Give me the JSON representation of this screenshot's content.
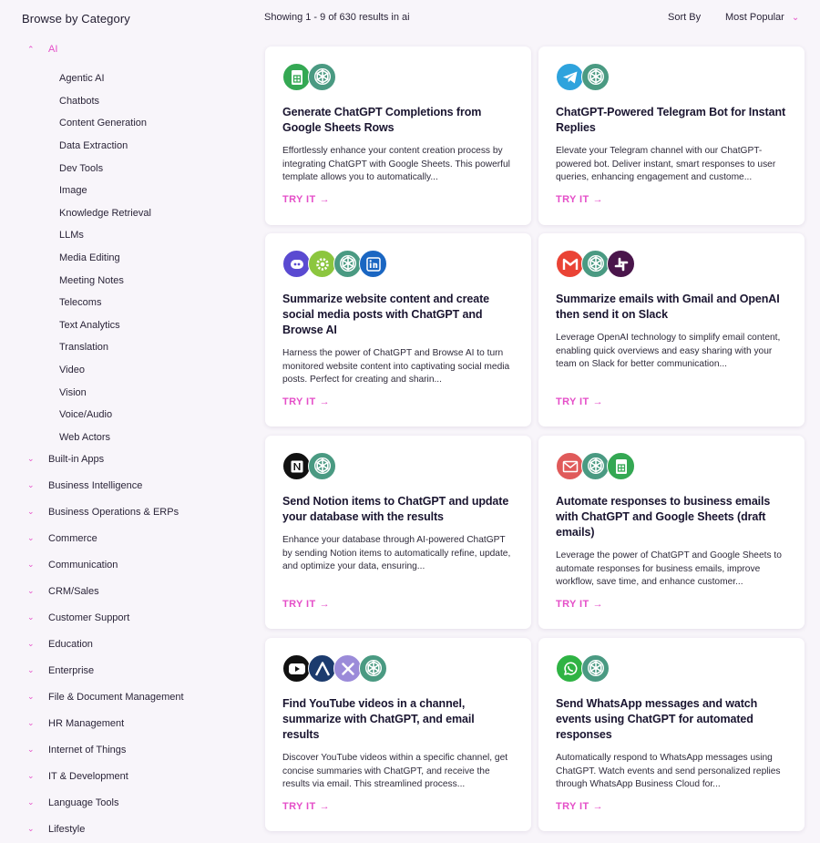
{
  "sidebar": {
    "title": "Browse by Category",
    "active_category": "AI",
    "subcategories": [
      "Agentic AI",
      "Chatbots",
      "Content Generation",
      "Data Extraction",
      "Dev Tools",
      "Image",
      "Knowledge Retrieval",
      "LLMs",
      "Media Editing",
      "Meeting Notes",
      "Telecoms",
      "Text Analytics",
      "Translation",
      "Video",
      "Vision",
      "Voice/Audio",
      "Web Actors"
    ],
    "categories": [
      "Built-in Apps",
      "Business Intelligence",
      "Business Operations & ERPs",
      "Commerce",
      "Communication",
      "CRM/Sales",
      "Customer Support",
      "Education",
      "Enterprise",
      "File & Document Management",
      "HR Management",
      "Internet of Things",
      "IT & Development",
      "Language Tools",
      "Lifestyle"
    ]
  },
  "topbar": {
    "results_text": "Showing 1 - 9 of 630 results in ai",
    "sort_label": "Sort By",
    "sort_value": "Most Popular"
  },
  "cards": [
    {
      "title": "Generate ChatGPT Completions from Google Sheets Rows",
      "desc": "Effortlessly enhance your content creation process by integrating ChatGPT with Google Sheets. This powerful template allows you to automatically...",
      "cta": "TRY IT",
      "icons": [
        "google-sheets-icon",
        "chatgpt-icon"
      ]
    },
    {
      "title": "ChatGPT-Powered Telegram Bot for Instant Replies",
      "desc": "Elevate your Telegram channel with our ChatGPT-powered bot. Deliver instant, smart responses to user queries, enhancing engagement and custome...",
      "cta": "TRY IT",
      "icons": [
        "telegram-icon",
        "chatgpt-icon"
      ]
    },
    {
      "title": "Summarize website content and create social media posts with ChatGPT and Browse AI",
      "desc": "Harness the power of ChatGPT and Browse AI to turn monitored website content into captivating social media posts. Perfect for creating and sharin...",
      "cta": "TRY IT",
      "icons": [
        "browse-ai-icon",
        "settings-icon",
        "chatgpt-icon",
        "linkedin-icon"
      ]
    },
    {
      "title": "Summarize emails with Gmail and OpenAI then send it on Slack",
      "desc": "Leverage OpenAI technology to simplify email content, enabling quick overviews and easy sharing with your team on Slack for better communication...",
      "cta": "TRY IT",
      "icons": [
        "gmail-icon",
        "chatgpt-icon",
        "slack-icon"
      ]
    },
    {
      "title": "Send Notion items to ChatGPT and update your database with the results",
      "desc": "Enhance your database through AI-powered ChatGPT by sending Notion items to automatically refine, update, and optimize your data, ensuring...",
      "cta": "TRY IT",
      "icons": [
        "notion-icon",
        "chatgpt-icon"
      ]
    },
    {
      "title": "Automate responses to business emails with ChatGPT and Google Sheets (draft emails)",
      "desc": "Leverage the power of ChatGPT and Google Sheets to automate responses for business emails, improve workflow, save time, and enhance customer...",
      "cta": "TRY IT",
      "icons": [
        "email-icon",
        "chatgpt-icon",
        "google-sheets-icon"
      ]
    },
    {
      "title": "Find YouTube videos in a channel, summarize with ChatGPT, and email results",
      "desc": "Discover YouTube videos within a specific channel, get concise summaries with ChatGPT, and receive the results via email. This streamlined process...",
      "cta": "TRY IT",
      "icons": [
        "youtube-icon",
        "a-logo-icon",
        "x-logo-icon",
        "chatgpt-icon"
      ]
    },
    {
      "title": "Send WhatsApp messages and watch events using ChatGPT for automated responses",
      "desc": "Automatically respond to WhatsApp messages using ChatGPT. Watch events and send personalized replies through WhatsApp Business Cloud for...",
      "cta": "TRY IT",
      "icons": [
        "whatsapp-icon",
        "chatgpt-icon"
      ]
    }
  ]
}
